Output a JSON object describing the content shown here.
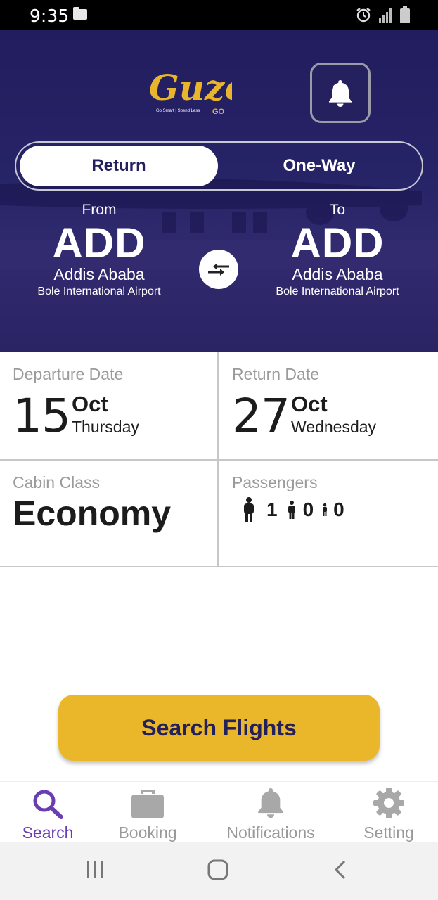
{
  "status_bar": {
    "time": "9:35"
  },
  "header": {
    "logo_text": "Guzo",
    "logo_suffix": "GO",
    "logo_tagline": "Go Smart | Spend Less"
  },
  "trip_type": {
    "options": [
      "Return",
      "One-Way"
    ],
    "selected": "Return"
  },
  "from": {
    "label": "From",
    "code": "ADD",
    "city": "Addis Ababa",
    "airport": "Bole International Airport"
  },
  "to": {
    "label": "To",
    "code": "ADD",
    "city": "Addis Ababa",
    "airport": "Bole International Airport"
  },
  "departure": {
    "label": "Departure Date",
    "day": "15",
    "month": "Oct",
    "weekday": "Thursday"
  },
  "return_date": {
    "label": "Return Date",
    "day": "27",
    "month": "Oct",
    "weekday": "Wednesday"
  },
  "cabin": {
    "label": "Cabin Class",
    "value": "Economy"
  },
  "passengers": {
    "label": "Passengers",
    "adults": "1",
    "children": "0",
    "infants": "0"
  },
  "search_button": "Search Flights",
  "bottom_nav": {
    "items": [
      {
        "label": "Search",
        "icon": "search-icon",
        "active": true
      },
      {
        "label": "Booking",
        "icon": "briefcase-icon",
        "active": false
      },
      {
        "label": "Notifications",
        "icon": "bell-icon",
        "active": false
      },
      {
        "label": "Setting",
        "icon": "gear-icon",
        "active": false
      }
    ]
  },
  "colors": {
    "brand_navy": "#23205c",
    "accent_yellow": "#ebb72a",
    "active_purple": "#6a3db0"
  }
}
